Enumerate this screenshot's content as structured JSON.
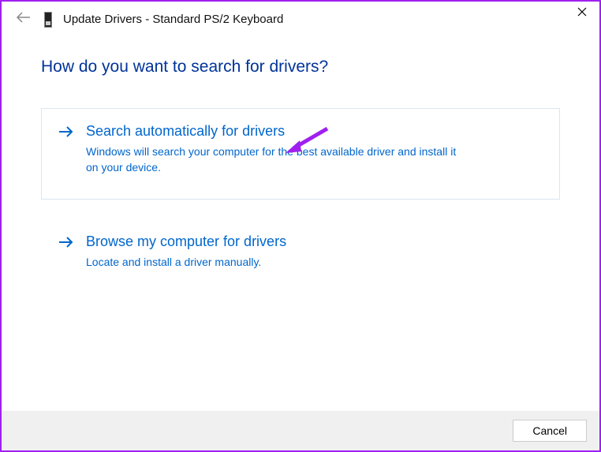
{
  "window": {
    "title": "Update Drivers - Standard PS/2 Keyboard"
  },
  "heading": "How do you want to search for drivers?",
  "options": [
    {
      "title": "Search automatically for drivers",
      "desc": "Windows will search your computer for the best available driver and install it on your device."
    },
    {
      "title": "Browse my computer for drivers",
      "desc": "Locate and install a driver manually."
    }
  ],
  "footer": {
    "cancel": "Cancel"
  }
}
